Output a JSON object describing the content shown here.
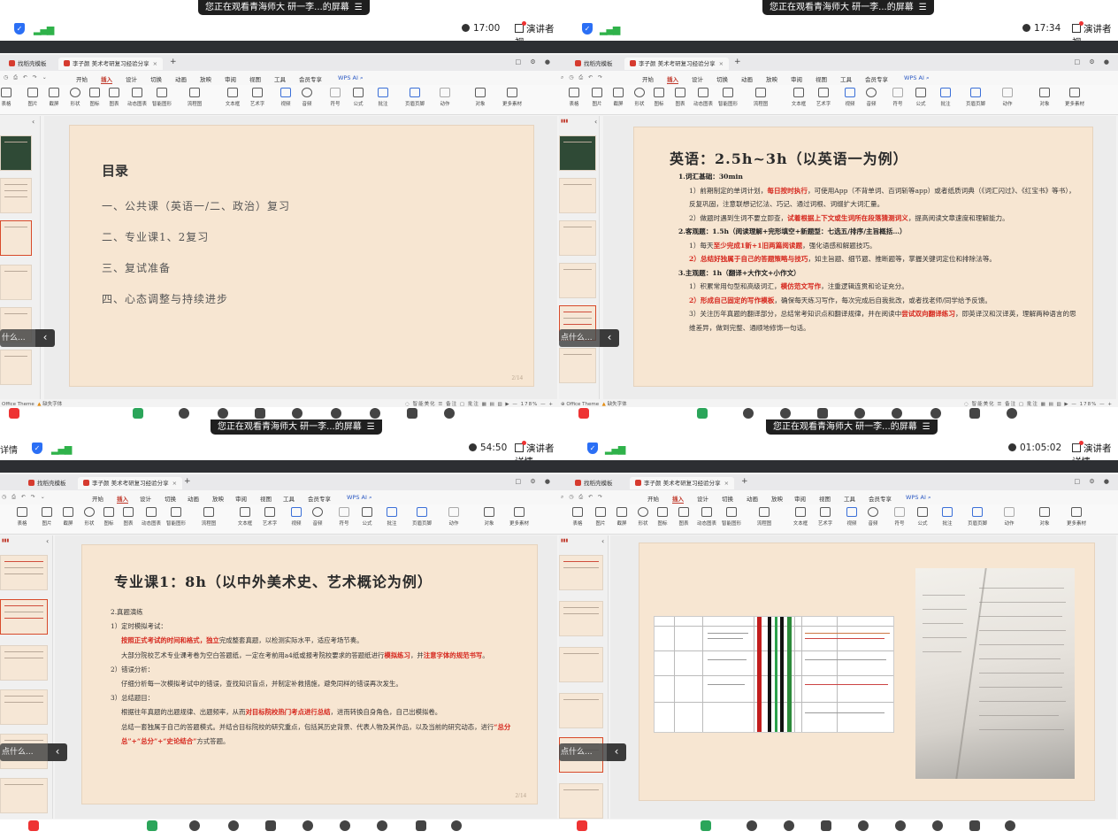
{
  "share_banner": {
    "text": "您正在观看青海师大 研一李...的屏幕",
    "icon": "menu-icon"
  },
  "quadrants": [
    {
      "id": "q1",
      "timer": "17:00",
      "left_label": "",
      "view_label": "演讲者视",
      "tabs": [
        "找稻壳模板",
        "李子颜 美术考研复习经验分享"
      ],
      "slide": {
        "type": "toc",
        "title": "目录",
        "items": [
          "一、公共课（英语一/二、政治）复习",
          "二、专业课1、2复习",
          "三、复试准备",
          "四、心态调整与持续进步"
        ],
        "page": "2/14"
      },
      "search_pill": "什么..."
    },
    {
      "id": "q2",
      "timer": "17:34",
      "left_label": "",
      "view_label": "演讲者视",
      "tabs": [
        "找稻壳模板",
        "李子颜 美术考研复习经验分享"
      ],
      "slide": {
        "type": "content",
        "title": "英语：2.5h~3h（以英语一为例）",
        "page": ""
      },
      "search_pill": "点什么..."
    },
    {
      "id": "q3",
      "timer": "54:50",
      "left_label": "详情",
      "view_label": "演讲者详情",
      "tabs": [
        "找稻壳模板",
        "李子颜 美术考研复习经验分享"
      ],
      "slide": {
        "type": "content",
        "title": "专业课1：8h（以中外美术史、艺术概论为例）",
        "page": "2/14"
      },
      "search_pill": "点什么..."
    },
    {
      "id": "q4",
      "timer": "01:05:02",
      "left_label": "",
      "view_label": "演讲者详情",
      "tabs": [
        "找稻壳模板",
        "李子颜 美术考研复习经验分享"
      ],
      "slide": {
        "type": "images",
        "title": "",
        "page": ""
      },
      "search_pill": "点什么..."
    }
  ],
  "menu": {
    "items": [
      "开始",
      "插入",
      "设计",
      "切换",
      "动画",
      "放映",
      "审阅",
      "视图",
      "工具",
      "会员专享"
    ],
    "active": "插入",
    "ai": "WPS AI"
  },
  "ribbon": [
    "表格",
    "图片",
    "截屏",
    "形状",
    "图标",
    "图表",
    "动态图表",
    "智能图形",
    "流程图",
    "思维导图",
    "文本框",
    "艺术字",
    "视频",
    "音频",
    "符号",
    "公式",
    "批注",
    "页眉页脚",
    "动作",
    "超链接",
    "对象",
    "附件",
    "更多素材"
  ],
  "status": {
    "theme": "Office Theme",
    "font_warn": "缺失字体",
    "smart": "智能美化",
    "notes": "备注",
    "comment": "批注",
    "zoom": "178%"
  },
  "english_slide": {
    "s1": "1.词汇基础：30min",
    "s1_p1_a": "1）前期制定的单词计划，",
    "s1_p1_red": "每日按时执行",
    "s1_p1_b": "，可使用App（不背单词、百词斩等app）或者纸质词典（《词汇闪过》、《红宝书》等书），反复巩固，注意联想记忆法、巧记、通过词根、词缀扩大词汇量。",
    "s1_p2_a": "2）做题时遇到生词不要立即查，",
    "s1_p2_red": "试着根据上下文或生词所在段落猜测词义",
    "s1_p2_b": "，提高阅读文章速度和理解能力。",
    "s2": "2.客观题：1.5h（阅读理解+完形填空+新题型：七选五/排序/主旨概括…）",
    "s2_p1_a": "1）每天",
    "s2_p1_red": "至少完成1新+1旧两篇阅读题",
    "s2_p1_b": "，强化语感和解题技巧。",
    "s2_p2_red": "2）总结好独属于自己的答题策略与技巧",
    "s2_p2_b": "，如主旨题、细节题、推断题等，掌握关键词定位和排除法等。",
    "s3": "3.主观题：1h（翻译+大作文+小作文）",
    "s3_p1_a": "1）积累常用句型和高级词汇，",
    "s3_p1_red": "模仿范文写作",
    "s3_p1_b": "，注重逻辑连贯和论证充分。",
    "s3_p2_red": "2）形成自己固定的写作模板",
    "s3_p2_b": "，确保每天练习写作，每次完成后自我批改，或者找老师/同学给予反馈。",
    "s3_p3_a": "3）关注历年真题的翻译部分，总结常考知识点和翻译规律，并在阅读中",
    "s3_p3_red": "尝试双向翻译练习",
    "s3_p3_b": "，即英译汉和汉译英，理解两种语言的思维差异，做到完整、通顺地修饰一句话。"
  },
  "major_slide": {
    "s0": "2.真题演练",
    "s1": "1）定时模拟考试：",
    "s1_red": "按照正式考试的时间和格式，独立",
    "s1_b": "完成整套真题，以检测实际水平，适应考场节奏。",
    "s1_c": "大部分院校艺术专业课考卷为空白答题纸，一定在考前用a4纸或报考院校要求的答题纸进行",
    "s1_c_red": "模拟练习",
    "s1_c2": "，并",
    "s1_c_red2": "注意字体的规范书写",
    "s1_c3": "。",
    "s2": "2）错误分析：",
    "s2_b": "仔细分析每一次模拟考试中的错误，查找知识盲点，并制定补救措施，避免同样的错误再次发生。",
    "s3": "3）总结题目：",
    "s3_b": "根据往年真题的出题规律、出题频率，从而",
    "s3_red": "对目标院校热门考点进行总结",
    "s3_b2": "，进而转换自身角色，自己出模拟卷。",
    "s3_c": "总结一套独属于自己的答题模式。并结合目标院校的研究重点，包括其历史背景、代表人物及其作品，以及当前的研究动态，进行",
    "s3_red2": "“总分总”+“总分”+“史论结合”",
    "s3_c2": "方式答题。"
  },
  "colors": {
    "slide_bg": "#f7e6d2",
    "accent_red": "#d6281e",
    "banner": "#1f1f1f",
    "active_tab": "#c0392b"
  }
}
